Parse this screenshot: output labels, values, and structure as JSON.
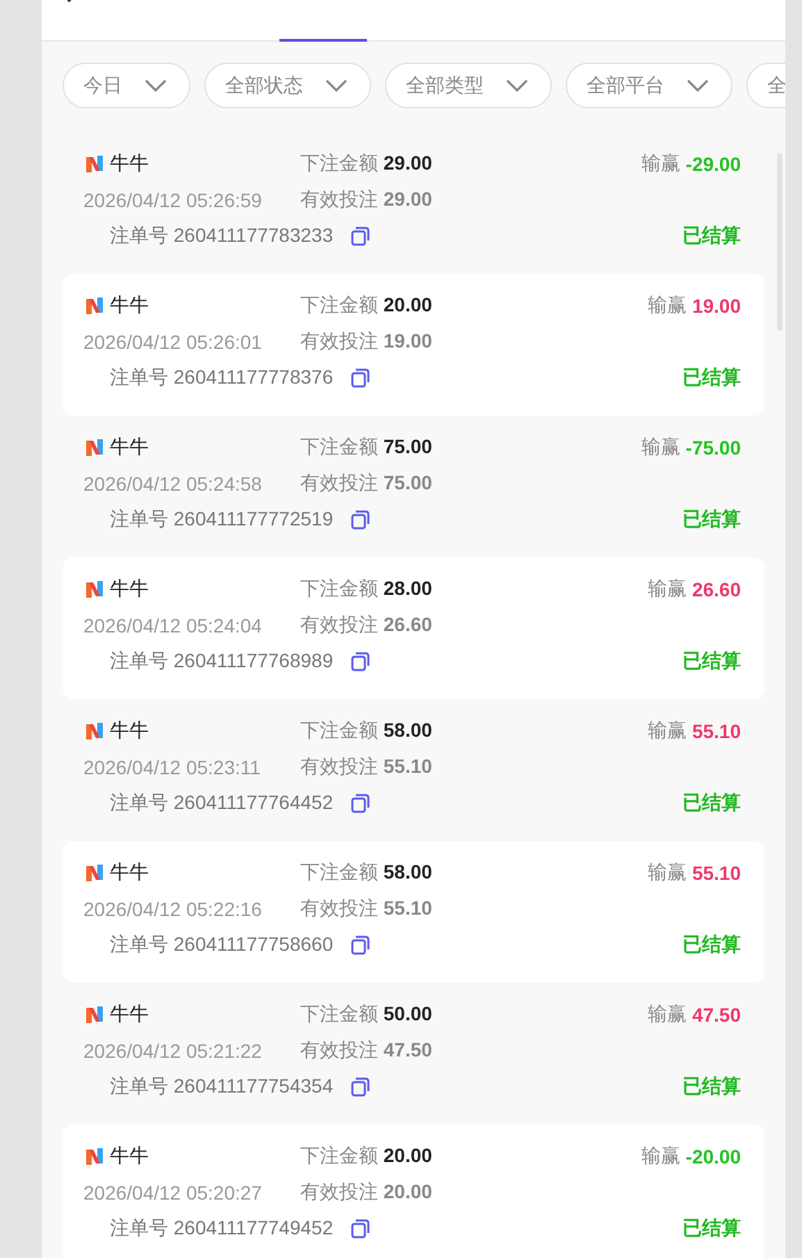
{
  "filters": [
    {
      "label": "今日"
    },
    {
      "label": "全部状态"
    },
    {
      "label": "全部类型"
    },
    {
      "label": "全部平台"
    },
    {
      "label": "全"
    }
  ],
  "bets": [
    {
      "game": "牛牛",
      "bet_label": "下注金额",
      "bet": "29.00",
      "time": "2026/04/12 05:26:59",
      "valid_label": "有效投注",
      "valid": "29.00",
      "order_label": "注单号",
      "order": "260411177783233",
      "winloss_label": "输赢",
      "winloss": "-29.00",
      "color": "#22c422",
      "status": "已结算"
    },
    {
      "game": "牛牛",
      "bet_label": "下注金额",
      "bet": "20.00",
      "time": "2026/04/12 05:26:01",
      "valid_label": "有效投注",
      "valid": "19.00",
      "order_label": "注单号",
      "order": "260411177778376",
      "winloss_label": "输赢",
      "winloss": "19.00",
      "color": "#f0386a",
      "status": "已结算"
    },
    {
      "game": "牛牛",
      "bet_label": "下注金额",
      "bet": "75.00",
      "time": "2026/04/12 05:24:58",
      "valid_label": "有效投注",
      "valid": "75.00",
      "order_label": "注单号",
      "order": "260411177772519",
      "winloss_label": "输赢",
      "winloss": "-75.00",
      "color": "#22c422",
      "status": "已结算"
    },
    {
      "game": "牛牛",
      "bet_label": "下注金额",
      "bet": "28.00",
      "time": "2026/04/12 05:24:04",
      "valid_label": "有效投注",
      "valid": "26.60",
      "order_label": "注单号",
      "order": "260411177768989",
      "winloss_label": "输赢",
      "winloss": "26.60",
      "color": "#f0386a",
      "status": "已结算"
    },
    {
      "game": "牛牛",
      "bet_label": "下注金额",
      "bet": "58.00",
      "time": "2026/04/12 05:23:11",
      "valid_label": "有效投注",
      "valid": "55.10",
      "order_label": "注单号",
      "order": "260411177764452",
      "winloss_label": "输赢",
      "winloss": "55.10",
      "color": "#f0386a",
      "status": "已结算"
    },
    {
      "game": "牛牛",
      "bet_label": "下注金额",
      "bet": "58.00",
      "time": "2026/04/12 05:22:16",
      "valid_label": "有效投注",
      "valid": "55.10",
      "order_label": "注单号",
      "order": "260411177758660",
      "winloss_label": "输赢",
      "winloss": "55.10",
      "color": "#f0386a",
      "status": "已结算"
    },
    {
      "game": "牛牛",
      "bet_label": "下注金额",
      "bet": "50.00",
      "time": "2026/04/12 05:21:22",
      "valid_label": "有效投注",
      "valid": "47.50",
      "order_label": "注单号",
      "order": "260411177754354",
      "winloss_label": "输赢",
      "winloss": "47.50",
      "color": "#f0386a",
      "status": "已结算"
    },
    {
      "game": "牛牛",
      "bet_label": "下注金额",
      "bet": "20.00",
      "time": "2026/04/12 05:20:27",
      "valid_label": "有效投注",
      "valid": "20.00",
      "order_label": "注单号",
      "order": "260411177749452",
      "winloss_label": "输赢",
      "winloss": "-20.00",
      "color": "#22c422",
      "status": "已结算"
    }
  ]
}
